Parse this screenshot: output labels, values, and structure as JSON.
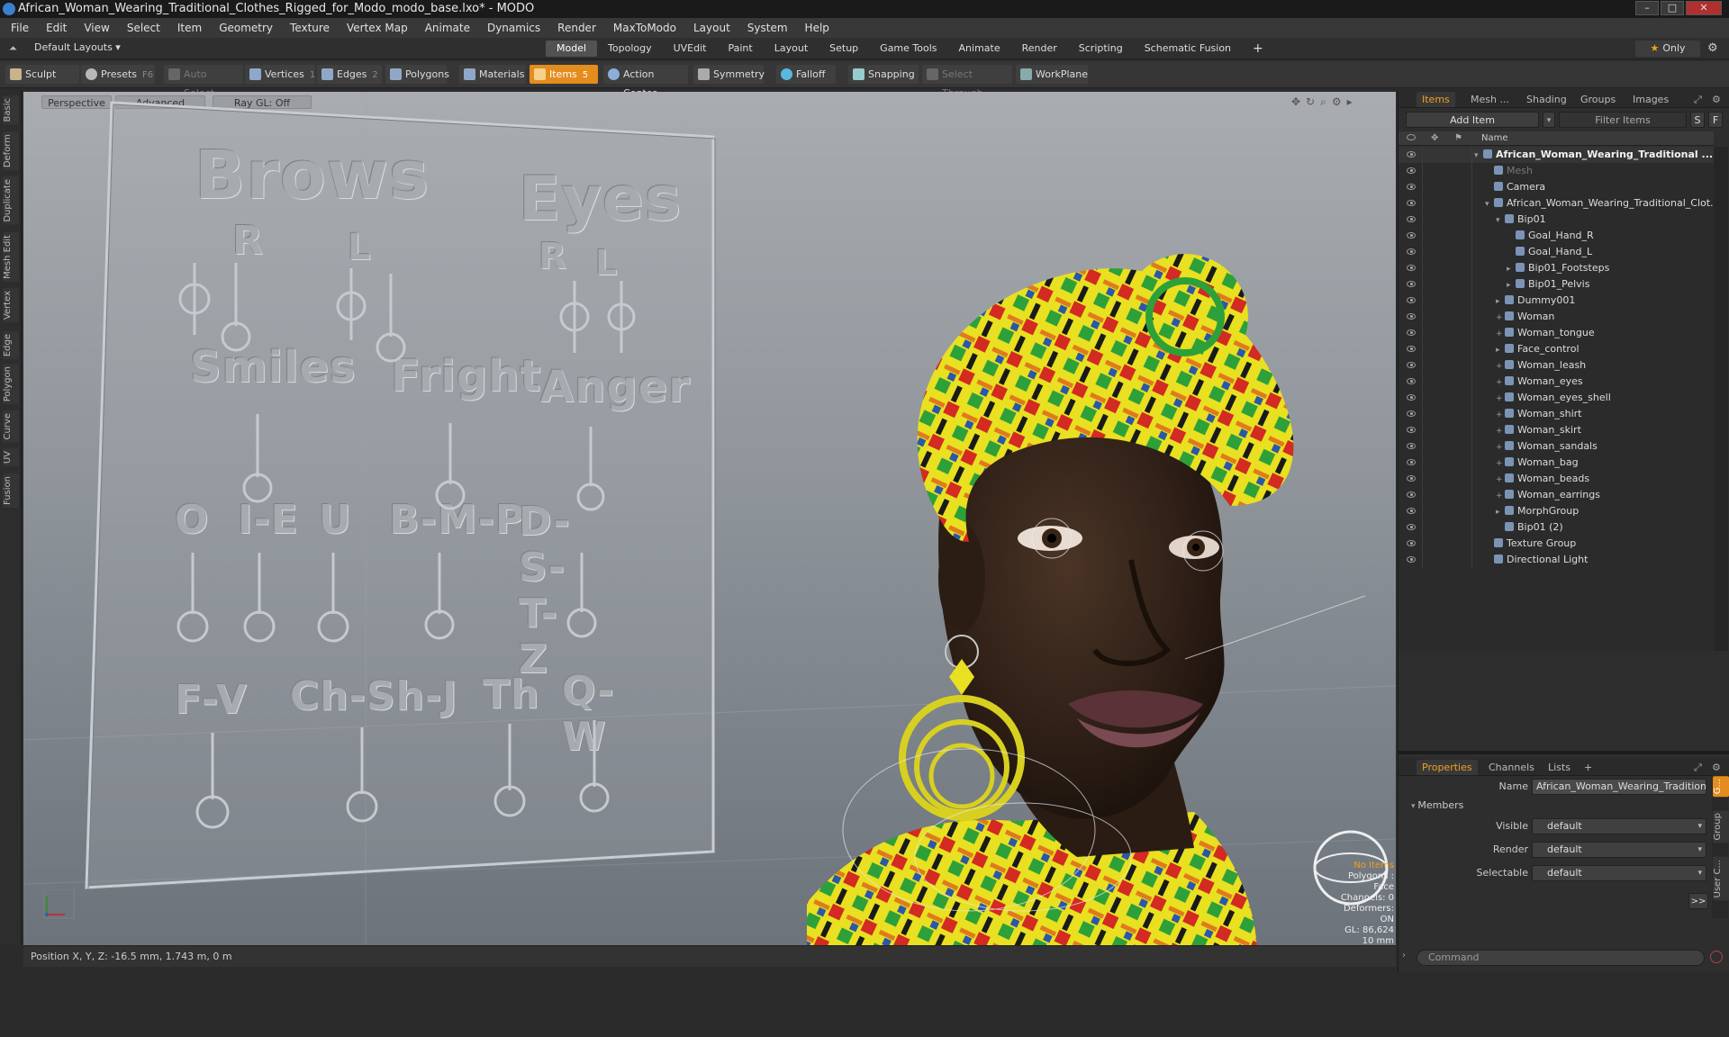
{
  "window": {
    "title": "African_Woman_Wearing_Traditional_Clothes_Rigged_for_Modo_modo_base.lxo* - MODO",
    "minimize": "–",
    "maximize": "□",
    "close": "✕"
  },
  "menu": [
    "File",
    "Edit",
    "View",
    "Select",
    "Item",
    "Geometry",
    "Texture",
    "Vertex Map",
    "Animate",
    "Dynamics",
    "Render",
    "MaxToModo",
    "Layout",
    "System",
    "Help"
  ],
  "layout": {
    "selector": "Default Layouts ▾",
    "tabs": [
      "Model",
      "Topology",
      "UVEdit",
      "Paint",
      "Layout",
      "Setup",
      "Game Tools",
      "Animate",
      "Render",
      "Scripting",
      "Schematic Fusion"
    ],
    "active_tab": "Model",
    "add": "+",
    "only": "Only"
  },
  "toolbar": {
    "sculpt": "Sculpt",
    "presets": "Presets",
    "presets_key": "F6",
    "auto_select": "Auto Select",
    "vertices": "Vertices",
    "vertices_num": "1",
    "edges": "Edges",
    "edges_num": "2",
    "polygons": "Polygons",
    "materials": "Materials",
    "items": "Items",
    "items_num": "5",
    "action_center": "Action Center",
    "symmetry": "Symmetry",
    "falloff": "Falloff",
    "snapping": "Snapping",
    "select_through": "Select Through",
    "workplane": "WorkPlane"
  },
  "left_tabs": [
    "Basic",
    "Deform",
    "Duplicate",
    "Mesh Edit",
    "Vertex",
    "Edge",
    "Polygon",
    "Curve",
    "UV",
    "Fusion"
  ],
  "viewport": {
    "perspective": "Perspective",
    "advanced": "Advanced",
    "raygl": "Ray GL: Off",
    "hud": [
      "No Items",
      "Polygons : Face",
      "Channels: 0",
      "Deformers: ON",
      "GL: 86,624",
      "10 mm"
    ],
    "blend_labels": {
      "brows": "Brows",
      "eyes": "Eyes",
      "r1": "R",
      "l1": "L",
      "r2": "R",
      "l2": "L",
      "smiles": "Smiles",
      "fright": "Fright",
      "anger": "Anger",
      "o": "O",
      "ie": "I-E",
      "u": "U",
      "bmp": "B-M-P",
      "dstz": "D-S-T-Z",
      "fv": "F-V",
      "chshj": "Ch-Sh-J",
      "th": "Th",
      "qw": "Q-W"
    }
  },
  "status": {
    "position": "Position X, Y, Z:  -16.5 mm, 1.743 m, 0 m"
  },
  "panel": {
    "tabs": [
      "Items",
      "Mesh ...",
      "Shading",
      "Groups",
      "Images"
    ],
    "add_item": "Add Item",
    "filter": "Filter Items",
    "s": "S",
    "f": "F",
    "name_col": "Name",
    "tree": [
      {
        "label": "African_Woman_Wearing_Traditional ...",
        "indent": 0,
        "exp": "▾",
        "bold": true
      },
      {
        "label": "Mesh",
        "indent": 1,
        "exp": "",
        "dim": true
      },
      {
        "label": "Camera",
        "indent": 1,
        "exp": ""
      },
      {
        "label": "African_Woman_Wearing_Traditional_Clot...",
        "indent": 1,
        "exp": "▾"
      },
      {
        "label": "Bip01",
        "indent": 2,
        "exp": "▾"
      },
      {
        "label": "Goal_Hand_R",
        "indent": 3,
        "exp": ""
      },
      {
        "label": "Goal_Hand_L",
        "indent": 3,
        "exp": ""
      },
      {
        "label": "Bip01_Footsteps",
        "indent": 3,
        "exp": "▸"
      },
      {
        "label": "Bip01_Pelvis",
        "indent": 3,
        "exp": "▸"
      },
      {
        "label": "Dummy001",
        "indent": 2,
        "exp": "▸"
      },
      {
        "label": "Woman",
        "indent": 2,
        "exp": "+"
      },
      {
        "label": "Woman_tongue",
        "indent": 2,
        "exp": "+"
      },
      {
        "label": "Face_control",
        "indent": 2,
        "exp": "▸"
      },
      {
        "label": "Woman_leash",
        "indent": 2,
        "exp": "+"
      },
      {
        "label": "Woman_eyes",
        "indent": 2,
        "exp": "+"
      },
      {
        "label": "Woman_eyes_shell",
        "indent": 2,
        "exp": "+"
      },
      {
        "label": "Woman_shirt",
        "indent": 2,
        "exp": "+"
      },
      {
        "label": "Woman_skirt",
        "indent": 2,
        "exp": "+"
      },
      {
        "label": "Woman_sandals",
        "indent": 2,
        "exp": "+"
      },
      {
        "label": "Woman_bag",
        "indent": 2,
        "exp": "+"
      },
      {
        "label": "Woman_beads",
        "indent": 2,
        "exp": "+"
      },
      {
        "label": "Woman_earrings",
        "indent": 2,
        "exp": "+"
      },
      {
        "label": "MorphGroup",
        "indent": 2,
        "exp": "▸"
      },
      {
        "label": "Bip01 (2)",
        "indent": 2,
        "exp": ""
      },
      {
        "label": "Texture Group",
        "indent": 1,
        "exp": ""
      },
      {
        "label": "Directional Light",
        "indent": 1,
        "exp": ""
      }
    ],
    "prop_tabs": [
      "Properties",
      "Channels",
      "Lists"
    ],
    "name_label": "Name",
    "name_value": "African_Woman_Wearing_Traditional_Clo",
    "members": "Members",
    "visible_label": "Visible",
    "visible_value": "default",
    "render_label": "Render",
    "render_value": "default",
    "selectable_label": "Selectable",
    "selectable_value": "default",
    "more": ">>",
    "side_tabs": [
      "G...",
      "Group",
      "User C..."
    ],
    "command_placeholder": "Command"
  },
  "colors": {
    "accent": "#e48c1e",
    "title_bg": "#1a1a1a",
    "panel_bg": "#2e2e2e"
  }
}
